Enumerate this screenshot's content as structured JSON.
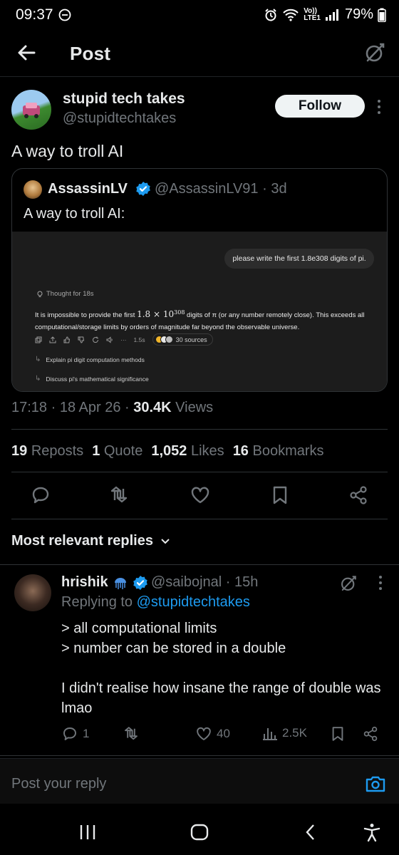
{
  "status_bar": {
    "time": "09:37",
    "network_top": "Vo))",
    "network_bottom": "LTE1",
    "battery": "79%"
  },
  "header": {
    "title": "Post"
  },
  "post": {
    "author_name": "stupid tech takes",
    "author_handle": "@stupidtechtakes",
    "follow_label": "Follow",
    "text": "A way to troll AI",
    "quote": {
      "author_name": "AssassinLV",
      "handle_time": "@AssassinLV91 · 3d",
      "text": "A way to troll AI:",
      "media": {
        "prompt": "please write the first 1.8e308 digits of pi.",
        "thought": "Thought for 18s",
        "answer_pre": "It is impossible to provide the first ",
        "answer_math": "1.8 × 10",
        "answer_exp": "308",
        "answer_post": " digits of π (or any number remotely close). This exceeds all computational/storage limits by orders of magnitude far beyond the observable universe.",
        "time_label": "1.5s",
        "sources_label": "30 sources",
        "suggestion_1": "Explain pi digit computation methods",
        "suggestion_2": "Discuss pi's mathematical significance"
      }
    },
    "meta": {
      "time_date": "17:18 · 18 Apr 26 · ",
      "views_count": "30.4K",
      "views_label": " Views"
    },
    "stats": {
      "reposts_count": "19",
      "reposts_label": "Reposts",
      "quotes_count": "1",
      "quotes_label": "Quote",
      "likes_count": "1,052",
      "likes_label": "Likes",
      "bookmarks_count": "16",
      "bookmarks_label": "Bookmarks"
    }
  },
  "replies": {
    "sort_label": "Most relevant replies",
    "items": [
      {
        "name": "hrishik",
        "handle_time": "@saibojnal · 15h",
        "replying_prefix": "Replying to ",
        "replying_to": "@stupidtechtakes",
        "body": "> all computational limits\n> number can be stored in a double\n\nI didn't realise how insane the range of double was lmao",
        "reply_count": "1",
        "like_count": "40",
        "view_count": "2.5K"
      }
    ]
  },
  "composer": {
    "placeholder": "Post your reply"
  },
  "colors": {
    "accent": "#1d9bf0",
    "background": "#000000",
    "muted": "#71767b",
    "text": "#e7e9ea"
  }
}
